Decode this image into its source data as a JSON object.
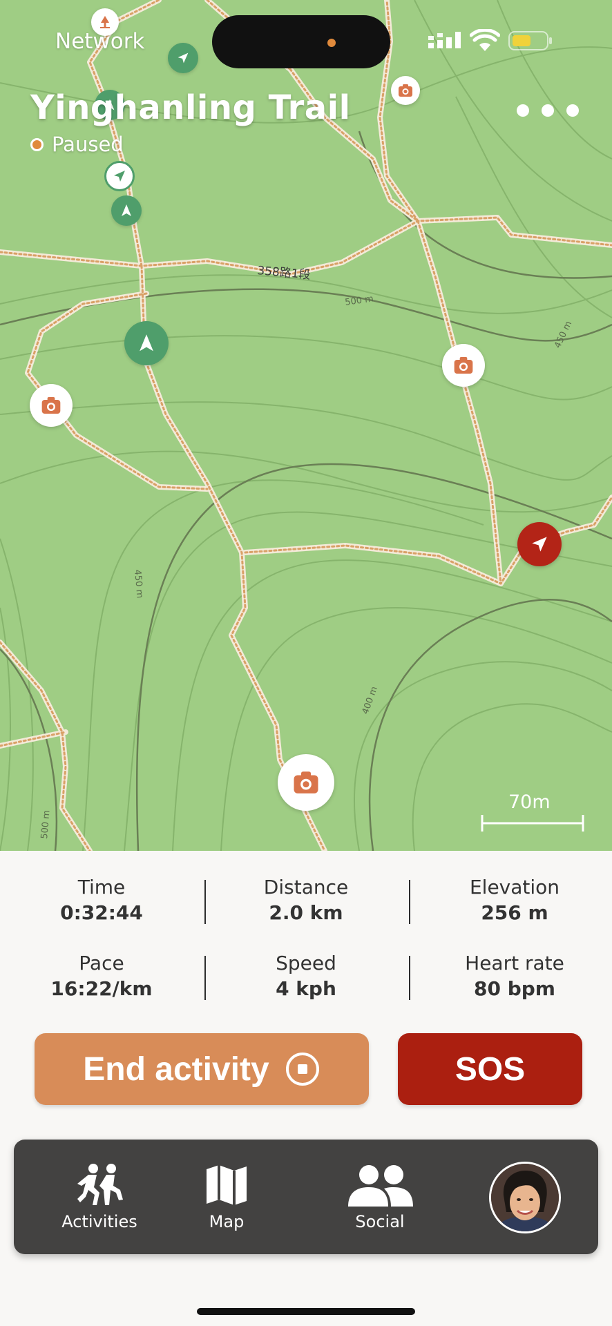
{
  "status_bar": {
    "network_label": "Network",
    "signal_icon": "signal-bars-icon",
    "wifi_icon": "wifi-icon",
    "battery_icon": "battery-icon"
  },
  "header": {
    "title": "Yinghanling Trail",
    "status": "Paused",
    "more_icon": "more-dots-icon"
  },
  "map": {
    "road_label": "358路1段",
    "contour_labels": [
      "500 m",
      "450 m",
      "450 m",
      "400 m",
      "500 m"
    ],
    "scale_label": "70m"
  },
  "stats": [
    {
      "label": "Time",
      "value": "0:32:44"
    },
    {
      "label": "Distance",
      "value": "2.0 km"
    },
    {
      "label": "Elevation",
      "value": "256 m"
    },
    {
      "label": "Pace",
      "value": "16:22/km"
    },
    {
      "label": "Speed",
      "value": "4 kph"
    },
    {
      "label": "Heart rate",
      "value": "80 bpm"
    }
  ],
  "actions": {
    "end_label": "End activity",
    "sos_label": "SOS"
  },
  "tabs": [
    {
      "label": "Activities",
      "icon": "activities-icon"
    },
    {
      "label": "Map",
      "icon": "map-icon"
    },
    {
      "label": "Social",
      "icon": "social-icon"
    }
  ],
  "colors": {
    "map_green": "#9fcd84",
    "trail": "#e8c79a",
    "accent_orange": "#d88c58",
    "sos_red": "#ab1f10",
    "tabbar": "#434241",
    "marker_green": "#4f9e6b"
  }
}
